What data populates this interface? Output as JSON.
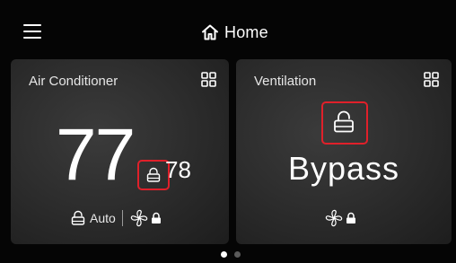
{
  "header": {
    "title": "Home"
  },
  "cards": {
    "air_conditioner": {
      "title": "Air Conditioner",
      "current_temp": "77",
      "setpoint": "78",
      "mode_label": "Auto"
    },
    "ventilation": {
      "title": "Ventilation",
      "status": "Bypass"
    }
  },
  "pagination": {
    "total_pages": 2,
    "active_page": 1
  },
  "icons": [
    "menu-icon",
    "home-icon",
    "grid-icon",
    "lock-icon",
    "fan-icon"
  ],
  "colors": {
    "background": "#050505",
    "card": "#2e2e2e",
    "highlight": "#e0202a",
    "text": "#ffffff"
  }
}
